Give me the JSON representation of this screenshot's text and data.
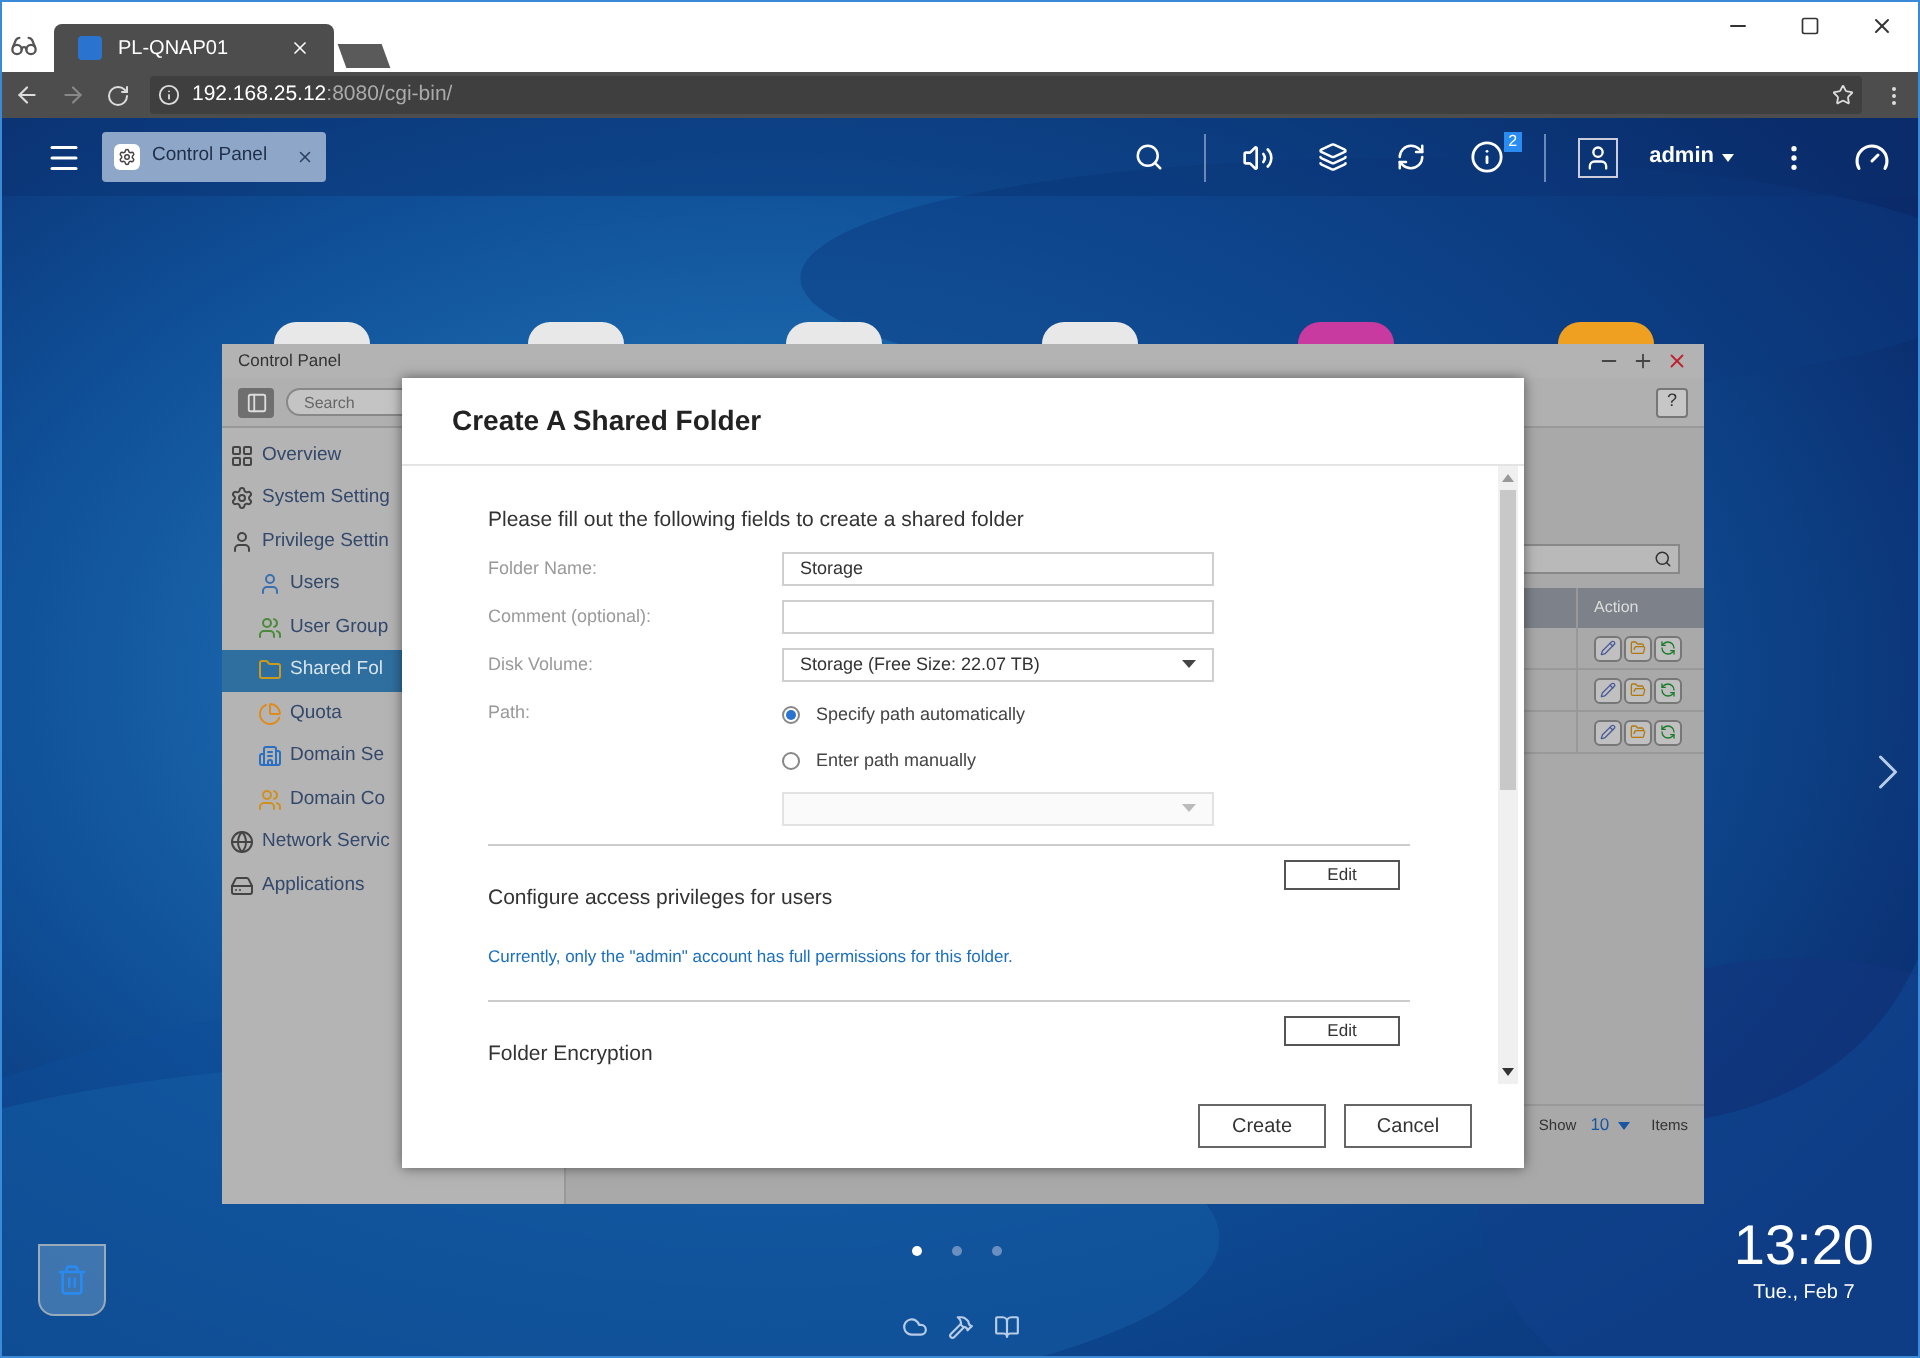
{
  "browser": {
    "tabs": [
      {
        "title": "PL-QNAP01",
        "selected": true
      }
    ],
    "url": {
      "host": "192.168.25.12",
      "rest": ":8080/cgi-bin/"
    }
  },
  "top_bar": {
    "app_tab": {
      "label": "Control Panel"
    },
    "notification_count": "2",
    "user": "admin"
  },
  "control_panel": {
    "title": "Control Panel",
    "search": {
      "placeholder": "Search"
    },
    "sidebar": [
      {
        "label": "Overview",
        "selected": false
      },
      {
        "label": "System Setting",
        "selected": false
      },
      {
        "label": "Privilege Settin",
        "selected": false,
        "children": [
          {
            "label": "Users",
            "selected": false
          },
          {
            "label": "User Group",
            "selected": false
          },
          {
            "label": "Shared Fol",
            "selected": true
          },
          {
            "label": "Quota",
            "selected": false
          },
          {
            "label": "Domain Se",
            "selected": false
          },
          {
            "label": "Domain Co",
            "selected": false
          }
        ]
      },
      {
        "label": "Network Servic",
        "selected": false
      },
      {
        "label": "Applications",
        "selected": false
      }
    ],
    "help_button": "?",
    "table": {
      "columns": [
        "Action"
      ],
      "rows": [
        {
          "kind": "actions"
        },
        {
          "kind": "actions"
        },
        {
          "kind": "actions"
        }
      ]
    },
    "pager": {
      "show_label": "Show",
      "page_size": "10",
      "items_label": "Items"
    }
  },
  "dialog": {
    "title": "Create A Shared Folder",
    "intro": "Please fill out the following fields to create a shared folder",
    "fields": [
      {
        "kind": "text",
        "label": "Folder Name:",
        "value": "Storage"
      },
      {
        "kind": "text",
        "label": "Comment (optional):"
      },
      {
        "kind": "select",
        "label": "Disk Volume:",
        "value": "Storage (Free Size: 22.07 TB)",
        "disabled": false
      },
      {
        "kind": "radio",
        "label": "Path:",
        "options": [
          {
            "label": "Specify path automatically",
            "selected": true
          },
          {
            "label": "Enter path manually",
            "selected": false
          }
        ]
      },
      {
        "kind": "select",
        "disabled": true
      }
    ],
    "sections": [
      {
        "title": "Configure access privileges for users",
        "button": "Edit",
        "note": "Currently, only the \"admin\" account has full permissions for this folder."
      },
      {
        "title": "Folder Encryption",
        "button": "Edit"
      }
    ],
    "buttons": [
      "Create",
      "Cancel"
    ]
  },
  "desktop": {
    "page_dots": [
      {
        "selected": true
      },
      {
        "selected": false
      },
      {
        "selected": false
      }
    ],
    "clock": {
      "time": "13:20",
      "date": "Tue., Feb 7"
    }
  }
}
